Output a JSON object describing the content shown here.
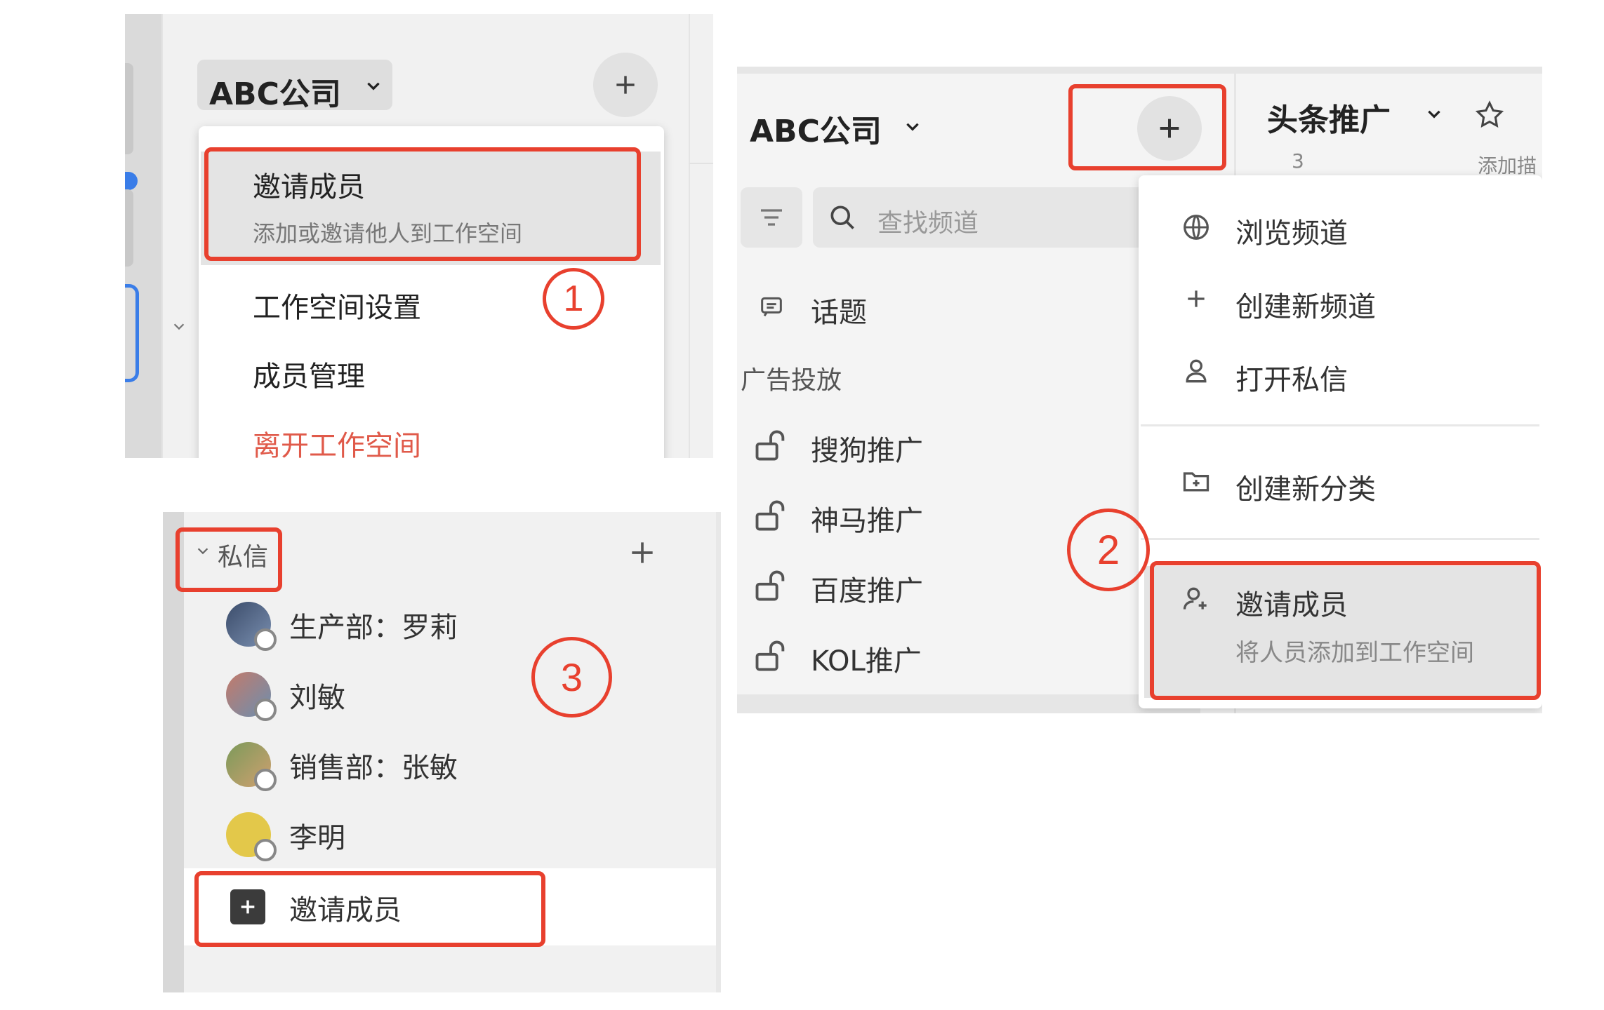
{
  "panel1": {
    "workspace_name": "ABC公司",
    "menu": {
      "invite": {
        "label": "邀请成员",
        "desc": "添加或邀请他人到工作空间"
      },
      "settings": "工作空间设置",
      "members": "成员管理",
      "leave": "离开工作空间"
    },
    "callout": "1"
  },
  "panel2": {
    "workspace_name": "ABC公司",
    "search_placeholder": "查找频道",
    "threads_label": "话题",
    "section_label": "广告投放",
    "channels": [
      "搜狗推广",
      "神马推广",
      "百度推广",
      "KOL推广"
    ],
    "channel_title": "头条推广",
    "header_meta": "添加描",
    "header_member_count": "3",
    "menu": {
      "browse": "浏览频道",
      "create_channel": "创建新频道",
      "open_dm": "打开私信",
      "create_category": "创建新分类",
      "invite": {
        "label": "邀请成员",
        "desc": "将人员添加到工作空间"
      }
    },
    "callout": "2"
  },
  "panel3": {
    "section_label": "私信",
    "dms": [
      {
        "name": "生产部：罗莉",
        "avatar_color": "#4a5d7a"
      },
      {
        "name": "刘敏",
        "avatar_color": "#c47a6a"
      },
      {
        "name": "销售部：张敏",
        "avatar_color": "#7b9a5a"
      },
      {
        "name": "李明",
        "avatar_color": "#e3c84a"
      }
    ],
    "invite_label": "邀请成员",
    "callout": "3"
  },
  "colors": {
    "highlight": "#e8402e",
    "danger": "#e05a4a",
    "panel_bg": "#f5f5f5",
    "menu_hover": "#e4e4e4"
  }
}
